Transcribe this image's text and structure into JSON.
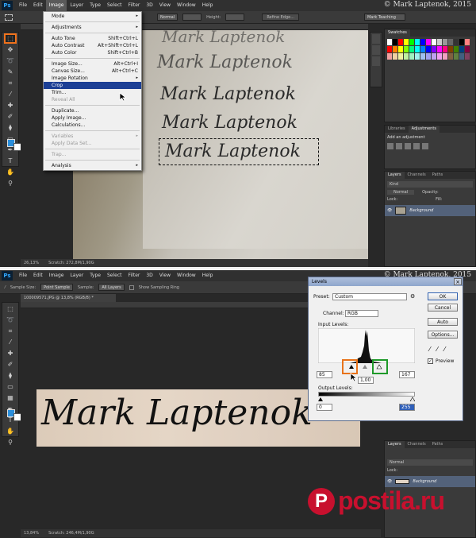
{
  "copyright": "© Mark Laptenok, 2015",
  "menubar": {
    "logo": "Ps",
    "items": [
      "File",
      "Edit",
      "Image",
      "Layer",
      "Type",
      "Select",
      "Filter",
      "3D",
      "View",
      "Window",
      "Help"
    ]
  },
  "top": {
    "options": {
      "style_value": "Normal",
      "height_label": "Height:",
      "refine_button": "Refine Edge...",
      "workspace": "Mark Teaching"
    },
    "image_menu": {
      "items": [
        {
          "label": "Mode",
          "shortcut": "",
          "submenu": true,
          "disabled": false
        },
        {
          "sep": true
        },
        {
          "label": "Adjustments",
          "shortcut": "",
          "submenu": true,
          "disabled": false
        },
        {
          "sep": true
        },
        {
          "label": "Auto Tone",
          "shortcut": "Shift+Ctrl+L",
          "disabled": false
        },
        {
          "label": "Auto Contrast",
          "shortcut": "Alt+Shift+Ctrl+L",
          "disabled": false
        },
        {
          "label": "Auto Color",
          "shortcut": "Shift+Ctrl+B",
          "disabled": false
        },
        {
          "sep": true
        },
        {
          "label": "Image Size...",
          "shortcut": "Alt+Ctrl+I",
          "disabled": false
        },
        {
          "label": "Canvas Size...",
          "shortcut": "Alt+Ctrl+C",
          "disabled": false
        },
        {
          "label": "Image Rotation",
          "shortcut": "",
          "submenu": true,
          "disabled": false
        },
        {
          "label": "Crop",
          "shortcut": "",
          "disabled": false,
          "highlight": true
        },
        {
          "label": "Trim...",
          "shortcut": "",
          "disabled": false
        },
        {
          "label": "Reveal All",
          "shortcut": "",
          "disabled": true
        },
        {
          "sep": true
        },
        {
          "label": "Duplicate...",
          "shortcut": "",
          "disabled": false
        },
        {
          "label": "Apply Image...",
          "shortcut": "",
          "disabled": false
        },
        {
          "label": "Calculations...",
          "shortcut": "",
          "disabled": false
        },
        {
          "sep": true
        },
        {
          "label": "Variables",
          "shortcut": "",
          "submenu": true,
          "disabled": true
        },
        {
          "label": "Apply Data Set...",
          "shortcut": "",
          "disabled": true
        },
        {
          "sep": true
        },
        {
          "label": "Trap...",
          "shortcut": "",
          "disabled": true
        },
        {
          "sep": true
        },
        {
          "label": "Analysis",
          "shortcut": "",
          "submenu": true,
          "disabled": false
        }
      ]
    },
    "handwriting": [
      "Mark Laptenok",
      "Mark Laptenok",
      "Mark Laptenok",
      "Mark Laptenok",
      "Mark Laptenok"
    ],
    "status": {
      "zoom": "26,13%",
      "doc": "Scratch: 272,8M/1,90G"
    },
    "swatches_tab": "Swatches",
    "adjustments_tabs": [
      "Libraries",
      "Adjustments"
    ],
    "add_adjustment": "Add an adjustment",
    "layers_tabs": [
      "Layers",
      "Channels",
      "Paths"
    ],
    "blend_mode": "Normal",
    "opacity_label": "Opacity:",
    "lock_label": "Lock:",
    "fill_label": "Fill:",
    "layer_name": "Background",
    "kind_label": "Kind"
  },
  "bottom": {
    "options": {
      "sample_size_label": "Sample Size:",
      "sample_size_value": "Point Sample",
      "sample_label": "Sample:",
      "sample_value": "All Layers",
      "show_ring": "Show Sampling Ring"
    },
    "doc_tab": "100009571.JPG @ 13,8% (RGB/8) *",
    "status": {
      "zoom": "13,84%",
      "doc": "Scratch: 246,4M/1,90G"
    },
    "handwriting": "Mark Laptenok",
    "layers_tabs": [
      "Layers",
      "Channels",
      "Paths"
    ],
    "blend_mode": "Normal",
    "layer_name": "Background",
    "lock_label": "Lock:",
    "levels": {
      "title": "Levels",
      "preset_label": "Preset:",
      "preset_value": "Custom",
      "channel_label": "Channel:",
      "channel_value": "RGB",
      "input_label": "Input Levels:",
      "input_black": "85",
      "input_gamma": "1,00",
      "input_white": "167",
      "output_label": "Output Levels:",
      "output_black": "0",
      "output_white": "255",
      "buttons": {
        "ok": "OK",
        "cancel": "Cancel",
        "auto": "Auto",
        "options": "Options..."
      },
      "preview_label": "Preview",
      "preview_checked": true,
      "highlight_colors": {
        "black_slider": "#e8731a",
        "white_slider": "#1f9a2a"
      }
    }
  },
  "watermark": {
    "text": "postila.ru",
    "color": "#c8102e"
  }
}
